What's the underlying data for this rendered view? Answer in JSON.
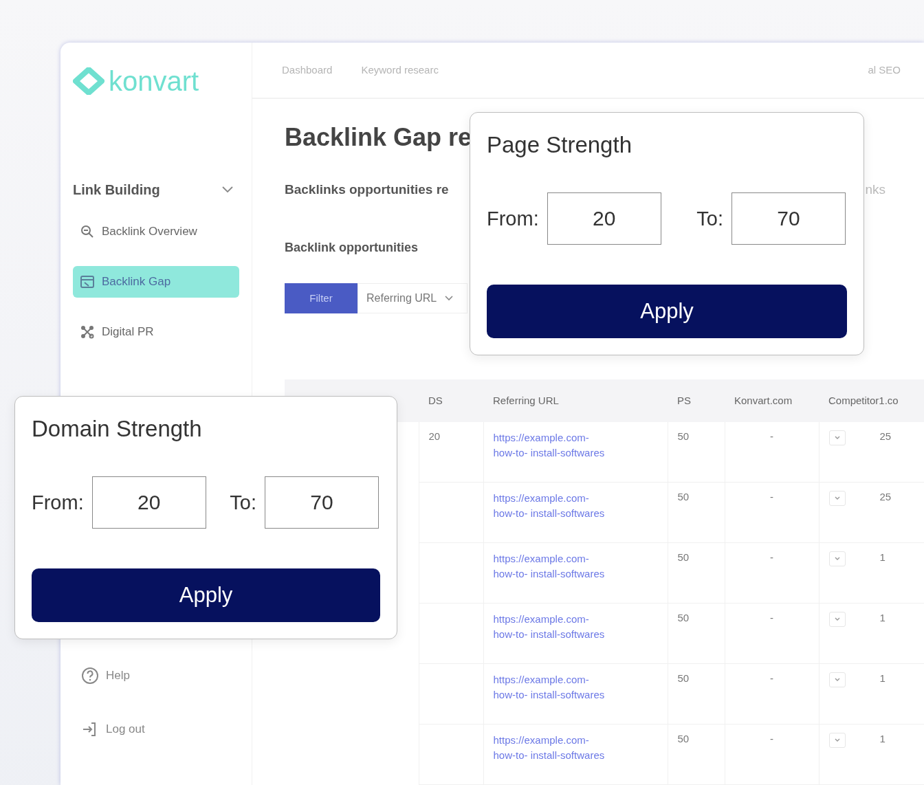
{
  "logo": {
    "name": "konvart"
  },
  "nav": [
    "Dashboard",
    "Keyword researc",
    "al SEO"
  ],
  "sidebar": {
    "group": {
      "label": "Link Building",
      "expanded": true
    },
    "items": [
      {
        "label": "Backlink Overview",
        "selected": false
      },
      {
        "label": "Backlink Gap",
        "selected": true
      },
      {
        "label": "Digital PR",
        "selected": false
      }
    ],
    "footer": [
      "Help",
      "Log out"
    ]
  },
  "page": {
    "title": "Backlink Gap re",
    "subtitle": "Backlinks opportunities re",
    "subtitle_right": "nks",
    "section": "Backlink opportunities"
  },
  "filter": {
    "button": "Filter",
    "dropdown": "Referring URL"
  },
  "table": {
    "columns": [
      "DS",
      "Referring URL",
      "PS",
      "Konvart.com",
      "Competitor1.co"
    ],
    "rows": [
      {
        "ds": "20",
        "url": "https://example.com-how-to- install-softwares",
        "ps": "50",
        "konvart": "-",
        "competitor": "25"
      },
      {
        "url": "https://example.com-how-to- install-softwares",
        "ps": "50",
        "konvart": "-",
        "competitor": "25"
      },
      {
        "url": "https://example.com-how-to- install-softwares",
        "ps": "50",
        "konvart": "-",
        "competitor": "1"
      },
      {
        "url": "https://example.com-how-to- install-softwares",
        "ps": "50",
        "konvart": "-",
        "competitor": "1"
      },
      {
        "url": "https://example.com-how-to- install-softwares",
        "ps": "50",
        "konvart": "-",
        "competitor": "1"
      },
      {
        "url": "https://example.com-how-to- install-softwares",
        "ps": "50",
        "konvart": "-",
        "competitor": "1"
      }
    ]
  },
  "popups": [
    {
      "title": "Page Strength",
      "from_label": "From:",
      "from_value": "20",
      "to_label": "To:",
      "to_value": "70",
      "button": "Apply"
    },
    {
      "title": "Domain Strength",
      "from_label": "From:",
      "from_value": "20",
      "to_label": "To:",
      "to_value": "70",
      "button": "Apply"
    }
  ]
}
